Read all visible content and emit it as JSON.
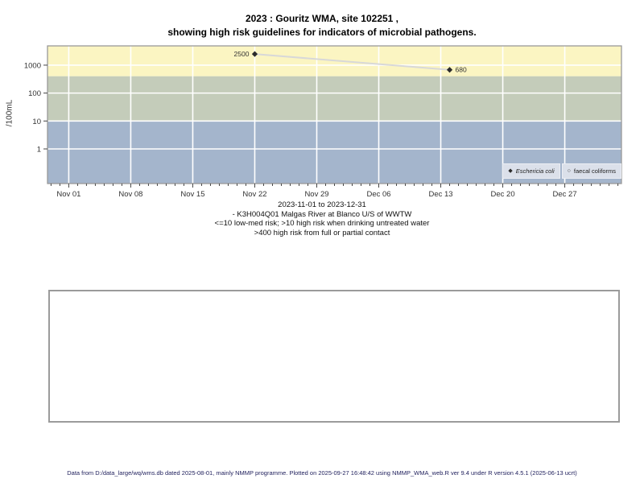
{
  "title": {
    "line1": "2023 : Gouritz WMA, site 102251 ,",
    "line2": "showing high risk guidelines for indicators of microbial pathogens."
  },
  "chart_data": {
    "type": "scatter",
    "title": "2023 : Gouritz WMA, site 102251 , showing high risk guidelines for indicators of microbial pathogens.",
    "xlabel": "",
    "ylabel": "/100mL",
    "y_scale": "log10",
    "y_ticks": [
      1,
      10,
      100,
      1000
    ],
    "y_log_range": [
      -1.24,
      3.69
    ],
    "x_start": "2023-11-01",
    "x_end": "2023-12-31",
    "x_range_days": [
      -2.4,
      62.4
    ],
    "x_ticks": [
      {
        "date": "2023-11-01",
        "label": "Nov 01"
      },
      {
        "date": "2023-11-08",
        "label": "Nov 08"
      },
      {
        "date": "2023-11-15",
        "label": "Nov 15"
      },
      {
        "date": "2023-11-22",
        "label": "Nov 22"
      },
      {
        "date": "2023-11-29",
        "label": "Nov 29"
      },
      {
        "date": "2023-12-06",
        "label": "Dec 06"
      },
      {
        "date": "2023-12-13",
        "label": "Dec 13"
      },
      {
        "date": "2023-12-20",
        "label": "Dec 20"
      },
      {
        "date": "2023-12-27",
        "label": "Dec 27"
      }
    ],
    "grid": "white major gridlines on, daily minor ticks",
    "bands": [
      {
        "name": "high-risk-full-partial-contact",
        "from": 400,
        "to": "top",
        "color": "#fbf5c2"
      },
      {
        "name": "high-risk-drinking-untreated",
        "from": 10,
        "to": 400,
        "color": "#c4ccba"
      },
      {
        "name": "low-med-risk",
        "from": "bottom",
        "to": 10,
        "color": "#a4b5cc"
      }
    ],
    "series": [
      {
        "name": "Eschericia coli",
        "symbol": "diamond-filled",
        "point_color": "#2b2b2b",
        "line_color": "#d8d8d8",
        "points": [
          {
            "date": "2023-11-22",
            "value": 2500,
            "label": "2500",
            "label_side": "left"
          },
          {
            "date": "2023-12-14",
            "value": 680,
            "label": "680",
            "label_side": "right"
          }
        ]
      },
      {
        "name": "faecal coliforms",
        "symbol": "circle-open",
        "points": []
      }
    ],
    "legend": {
      "position": "bottom-right",
      "entries": [
        {
          "glyph": "◆",
          "label": "Eschericia coli",
          "italic": true
        },
        {
          "glyph": "○",
          "label": "faecal coliforms",
          "italic": false
        }
      ]
    }
  },
  "caption": {
    "line1": "2023-11-01 to 2023-12-31",
    "line2": "- K3H004Q01 Malgas River at Blanco U/S of WWTW",
    "line3": "<=10 low-med risk; >10 high risk when drinking untreated water",
    "line4": ">400 high risk from full or partial contact"
  },
  "footer": "Data from D:/data_large/wq/wms.db dated 2025-08-01, mainly NMMP programme. Plotted on 2025-09-27 16:48:42 using NMMP_WMA_web.R ver 9.4 under R version 4.5.1 (2025-06-13 ucrt)"
}
